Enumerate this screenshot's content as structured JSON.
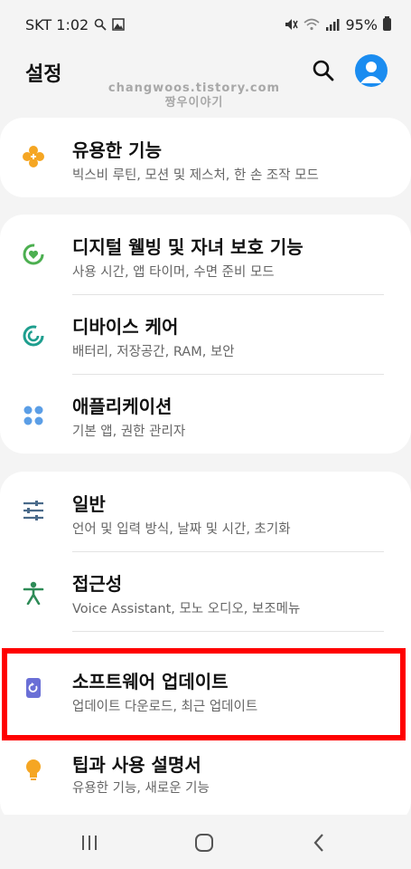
{
  "status_bar": {
    "carrier_time": "SKT 1:02",
    "battery": "95%"
  },
  "header": {
    "title": "설정",
    "watermark_line1": "changwoos.tistory.com",
    "watermark_line2": "짱우이야기"
  },
  "groups": [
    {
      "items": [
        {
          "title": "유용한 기능",
          "subtitle": "빅스비 루틴, 모션 및 제스처, 한 손 조작 모드",
          "icon": "puzzle-icon",
          "color": "#f5a623"
        }
      ]
    },
    {
      "items": [
        {
          "title": "디지털 웰빙 및 자녀 보호 기능",
          "subtitle": "사용 시간, 앱 타이머, 수면 준비 모드",
          "icon": "wellbeing-icon",
          "color": "#4caf50"
        },
        {
          "title": "디바이스 케어",
          "subtitle": "배터리, 저장공간, RAM, 보안",
          "icon": "device-care-icon",
          "color": "#1e9e8e"
        },
        {
          "title": "애플리케이션",
          "subtitle": "기본 앱, 권한 관리자",
          "icon": "apps-icon",
          "color": "#5b9ee6"
        }
      ]
    },
    {
      "items": [
        {
          "title": "일반",
          "subtitle": "언어 및 입력 방식, 날짜 및 시간, 초기화",
          "icon": "sliders-icon",
          "color": "#4a6a8a"
        },
        {
          "title": "접근성",
          "subtitle": "Voice Assistant, 모노 오디오, 보조메뉴",
          "icon": "accessibility-icon",
          "color": "#2e8b57"
        },
        {
          "title": "소프트웨어 업데이트",
          "subtitle": "업데이트 다운로드, 최근 업데이트",
          "icon": "software-update-icon",
          "color": "#6a6fd6"
        },
        {
          "title": "팁과 사용 설명서",
          "subtitle": "유용한 기능, 새로운 기능",
          "icon": "lightbulb-icon",
          "color": "#f5a623"
        }
      ]
    }
  ],
  "colors": {
    "highlight": "#ff0000",
    "avatar": "#1a8cf0",
    "background": "#f4f4f4"
  }
}
